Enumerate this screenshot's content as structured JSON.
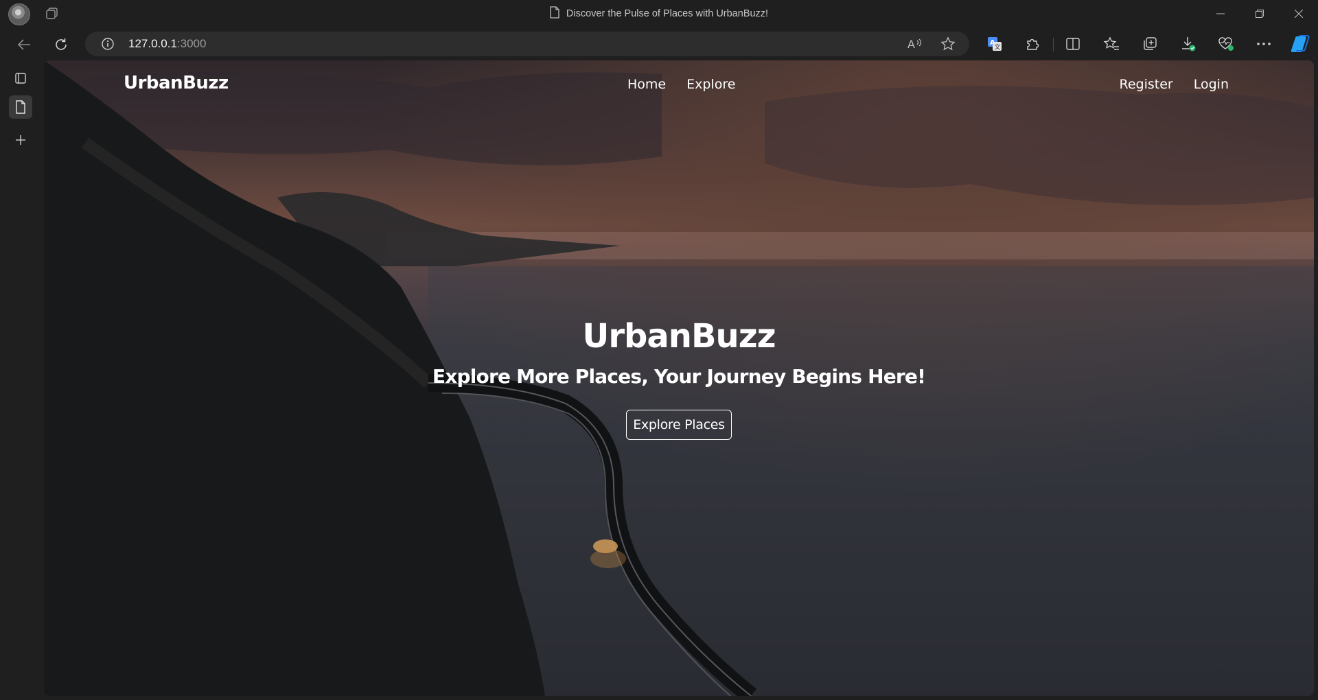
{
  "browser": {
    "window_title": "Discover the Pulse of Places with UrbanBuzz!",
    "address": {
      "host": "127.0.0.1",
      "port": ":3000"
    },
    "icons": {
      "profile": "profile-avatar",
      "workspaces": "workspaces-icon",
      "back": "back-arrow-icon",
      "refresh": "refresh-icon",
      "site_info": "info-icon",
      "read_aloud": "read-aloud-icon",
      "favorite": "star-icon",
      "translate": "translate-icon",
      "extensions": "puzzle-icon",
      "split_screen": "split-screen-icon",
      "favorites": "favorites-icon",
      "collections": "collections-icon",
      "downloads": "download-icon",
      "performance": "heart-pulse-icon",
      "more": "more-icon",
      "copilot": "copilot-icon"
    },
    "sidebar": {
      "items": [
        "tab-actions-icon",
        "page-tab-icon",
        "new-tab-icon"
      ]
    },
    "colors": {
      "chrome_bg": "#1f1f1f",
      "address_bg": "#2d2d2d",
      "accent_translate": "#4c8cf5",
      "copilot_blue": "#27a1f5"
    }
  },
  "site": {
    "brand": "UrbanBuzz",
    "nav_center": [
      "Home",
      "Explore"
    ],
    "nav_right": [
      "Register",
      "Login"
    ],
    "hero": {
      "title": "UrbanBuzz",
      "subtitle": "Explore More Places, Your Journey Begins Here!",
      "button": "Explore Places"
    }
  }
}
